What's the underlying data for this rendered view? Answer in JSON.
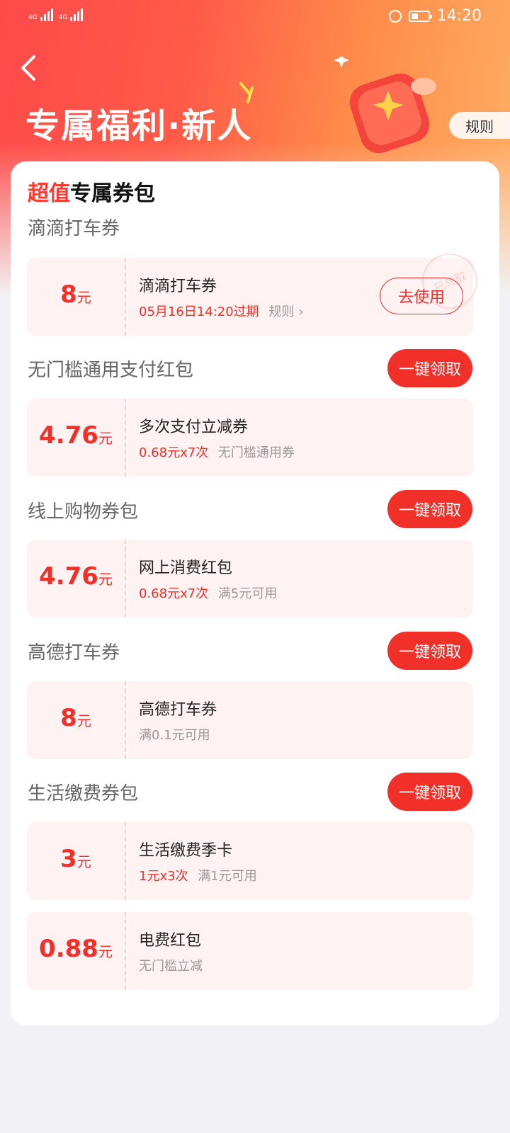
{
  "status_bar": {
    "time": "14:20",
    "network_1": "4G",
    "network_2": "4G"
  },
  "header": {
    "title": "专属福利·新人",
    "rules_label": "规则"
  },
  "card": {
    "title_highlight": "超值",
    "title_rest": "专属券包"
  },
  "sections": [
    {
      "label": "滴滴打车券",
      "coupons": [
        {
          "amount": "8",
          "unit": "元",
          "title": "滴滴打车券",
          "sub_red": "05月16日14:20过期",
          "sub_gray": "规则",
          "action": "去使用",
          "stamp": "已领取"
        }
      ]
    },
    {
      "label": "无门槛通用支付红包",
      "claim": "一键领取",
      "coupons": [
        {
          "amount": "4.76",
          "unit": "元",
          "title": "多次支付立减券",
          "sub_red": "0.68元x7次",
          "sub_gray": "无门槛通用券"
        }
      ]
    },
    {
      "label": "线上购物券包",
      "claim": "一键领取",
      "coupons": [
        {
          "amount": "4.76",
          "unit": "元",
          "title": "网上消费红包",
          "sub_red": "0.68元x7次",
          "sub_gray": "满5元可用"
        }
      ]
    },
    {
      "label": "高德打车券",
      "claim": "一键领取",
      "coupons": [
        {
          "amount": "8",
          "unit": "元",
          "title": "高德打车券",
          "sub_red": "",
          "sub_gray": "满0.1元可用"
        }
      ]
    },
    {
      "label": "生活缴费券包",
      "claim": "一键领取",
      "coupons": [
        {
          "amount": "3",
          "unit": "元",
          "title": "生活缴费季卡",
          "sub_red": "1元x3次",
          "sub_gray": "满1元可用"
        },
        {
          "amount": "0.88",
          "unit": "元",
          "title": "电费红包",
          "sub_red": "",
          "sub_gray": "无门槛立减"
        }
      ]
    }
  ],
  "colors": {
    "accent": "#f2302a",
    "coupon_bg": "#fff2f3",
    "page_bg": "#f2f2f6"
  }
}
